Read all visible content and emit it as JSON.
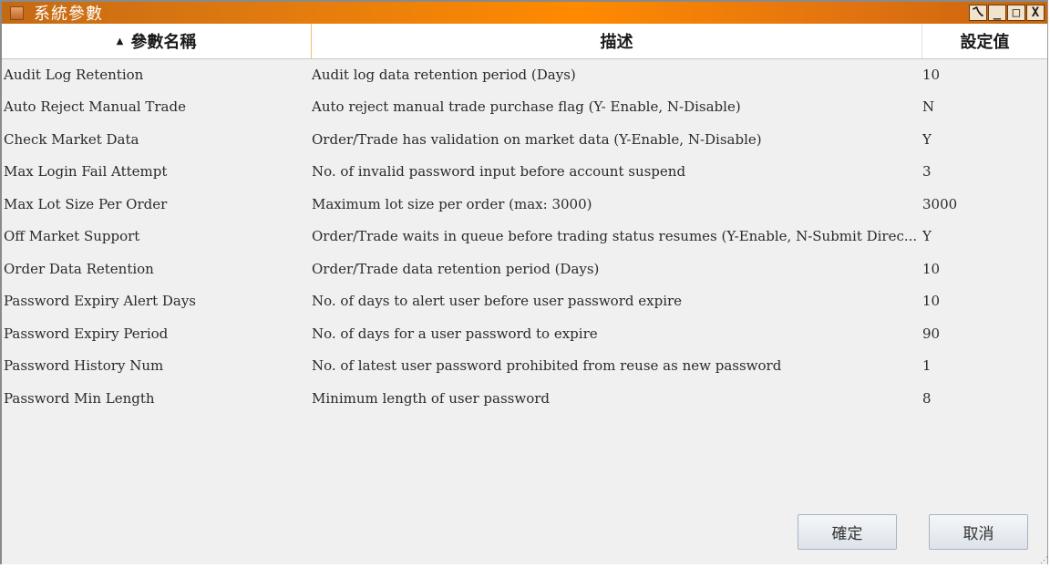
{
  "window": {
    "title": "系統參數",
    "controls": [
      "ㄟ",
      "_",
      "□",
      "X"
    ]
  },
  "table": {
    "columns": [
      "參數名稱",
      "描述",
      "設定值"
    ],
    "rows": [
      {
        "name": "Audit Log Retention",
        "description": "Audit log data retention period (Days)",
        "value": "10"
      },
      {
        "name": "Auto Reject Manual Trade",
        "description": "Auto reject manual trade purchase flag (Y- Enable, N-Disable)",
        "value": "N"
      },
      {
        "name": "Check Market Data",
        "description": "Order/Trade has validation on market data (Y-Enable, N-Disable)",
        "value": "Y"
      },
      {
        "name": "Max Login Fail Attempt",
        "description": "No. of invalid password input before account suspend",
        "value": "3"
      },
      {
        "name": "Max Lot Size Per Order",
        "description": "Maximum lot size per order  (max: 3000)",
        "value": "3000"
      },
      {
        "name": "Off Market Support",
        "description": "Order/Trade waits in queue before trading status resumes (Y-Enable, N-Submit Direc...",
        "value": "Y"
      },
      {
        "name": "Order Data Retention",
        "description": "Order/Trade data retention period (Days)",
        "value": "10"
      },
      {
        "name": "Password Expiry Alert Days",
        "description": "No. of days to alert user before user password expire",
        "value": "10"
      },
      {
        "name": "Password Expiry Period",
        "description": "No. of days for a user password to expire",
        "value": "90"
      },
      {
        "name": "Password History Num",
        "description": "No. of latest user password prohibited from reuse as new password",
        "value": "1"
      },
      {
        "name": "Password Min Length",
        "description": "Minimum length of user password",
        "value": "8"
      }
    ]
  },
  "footer": {
    "ok_label": "確定",
    "cancel_label": "取消"
  },
  "colors": {
    "titlebar_accent": "#ff8a00",
    "header_divider": "#f0c070"
  }
}
